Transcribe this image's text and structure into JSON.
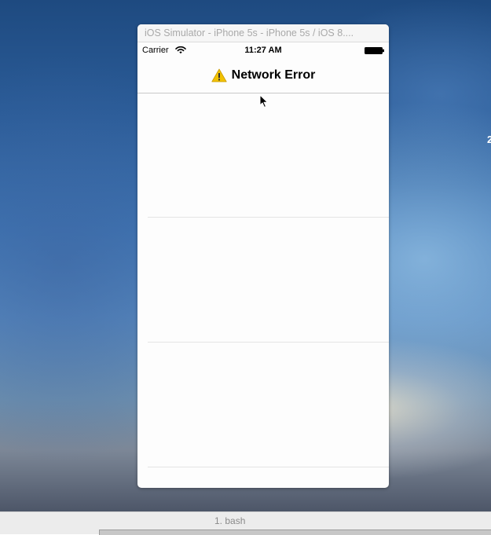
{
  "desktop": {
    "edge_text": "2"
  },
  "simulator": {
    "window_title": "iOS Simulator - iPhone 5s - iPhone 5s / iOS 8...."
  },
  "status_bar": {
    "carrier": "Carrier",
    "time": "11:27 AM",
    "wifi_icon": "wifi-icon",
    "battery_icon": "battery-icon"
  },
  "nav_bar": {
    "title": "Network Error",
    "icon": "warning-icon"
  },
  "table": {
    "row_count": 3
  },
  "terminal": {
    "tab_label": "1. bash"
  },
  "colors": {
    "warning_yellow": "#f2c200",
    "separator": "#e4e4e4",
    "nav_border": "#c9c9c9",
    "screen_background": "#fdfdfd"
  }
}
